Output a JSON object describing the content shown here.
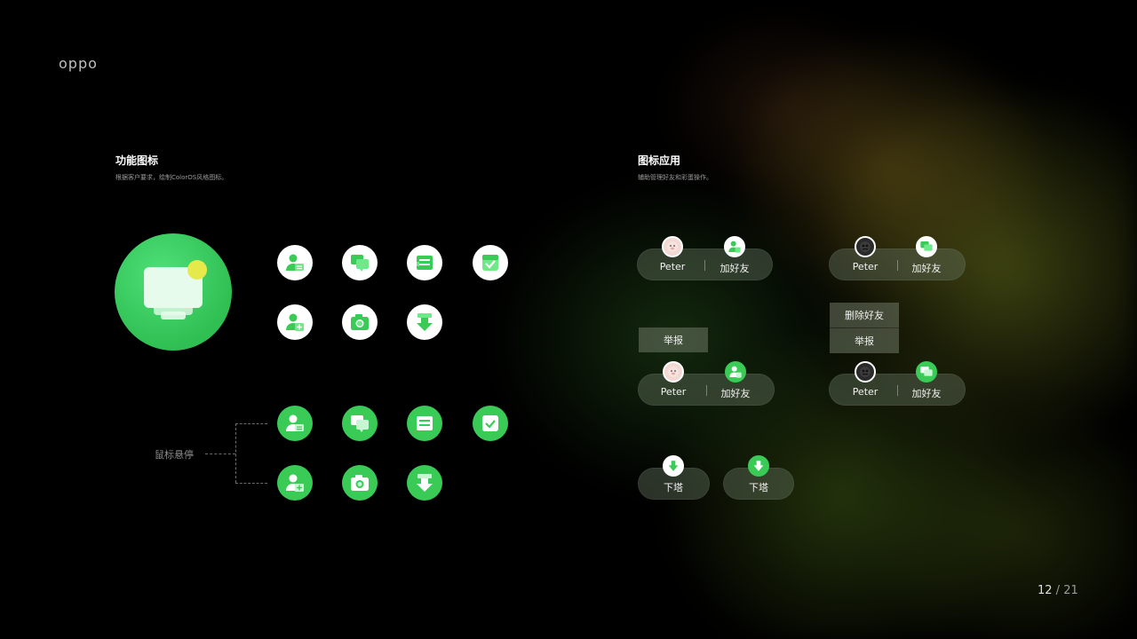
{
  "brand": {
    "logo": "oppo"
  },
  "left_section": {
    "title": "功能图标",
    "subtitle": "根据客户要求，绘制ColorOS风格图标。",
    "hover_label": "鼠标悬停"
  },
  "right_section": {
    "title": "图标应用",
    "subtitle": "辅助管理好友和彩蛋操作。",
    "cards": {
      "name": "Peter",
      "add_friend": "加好友",
      "report": "举报",
      "delete_friend": "删除好友",
      "download": "下塔"
    }
  },
  "icons": [
    "add-user-icon",
    "message-icon",
    "document-icon",
    "check-icon",
    "user-plus-icon",
    "camera-icon",
    "download-icon"
  ],
  "colors": {
    "accent": "#3acb56",
    "accent_light": "#6ee889",
    "dot": "#e6e94a"
  },
  "pagination": {
    "current": "12",
    "separator": " / ",
    "total": "21"
  }
}
